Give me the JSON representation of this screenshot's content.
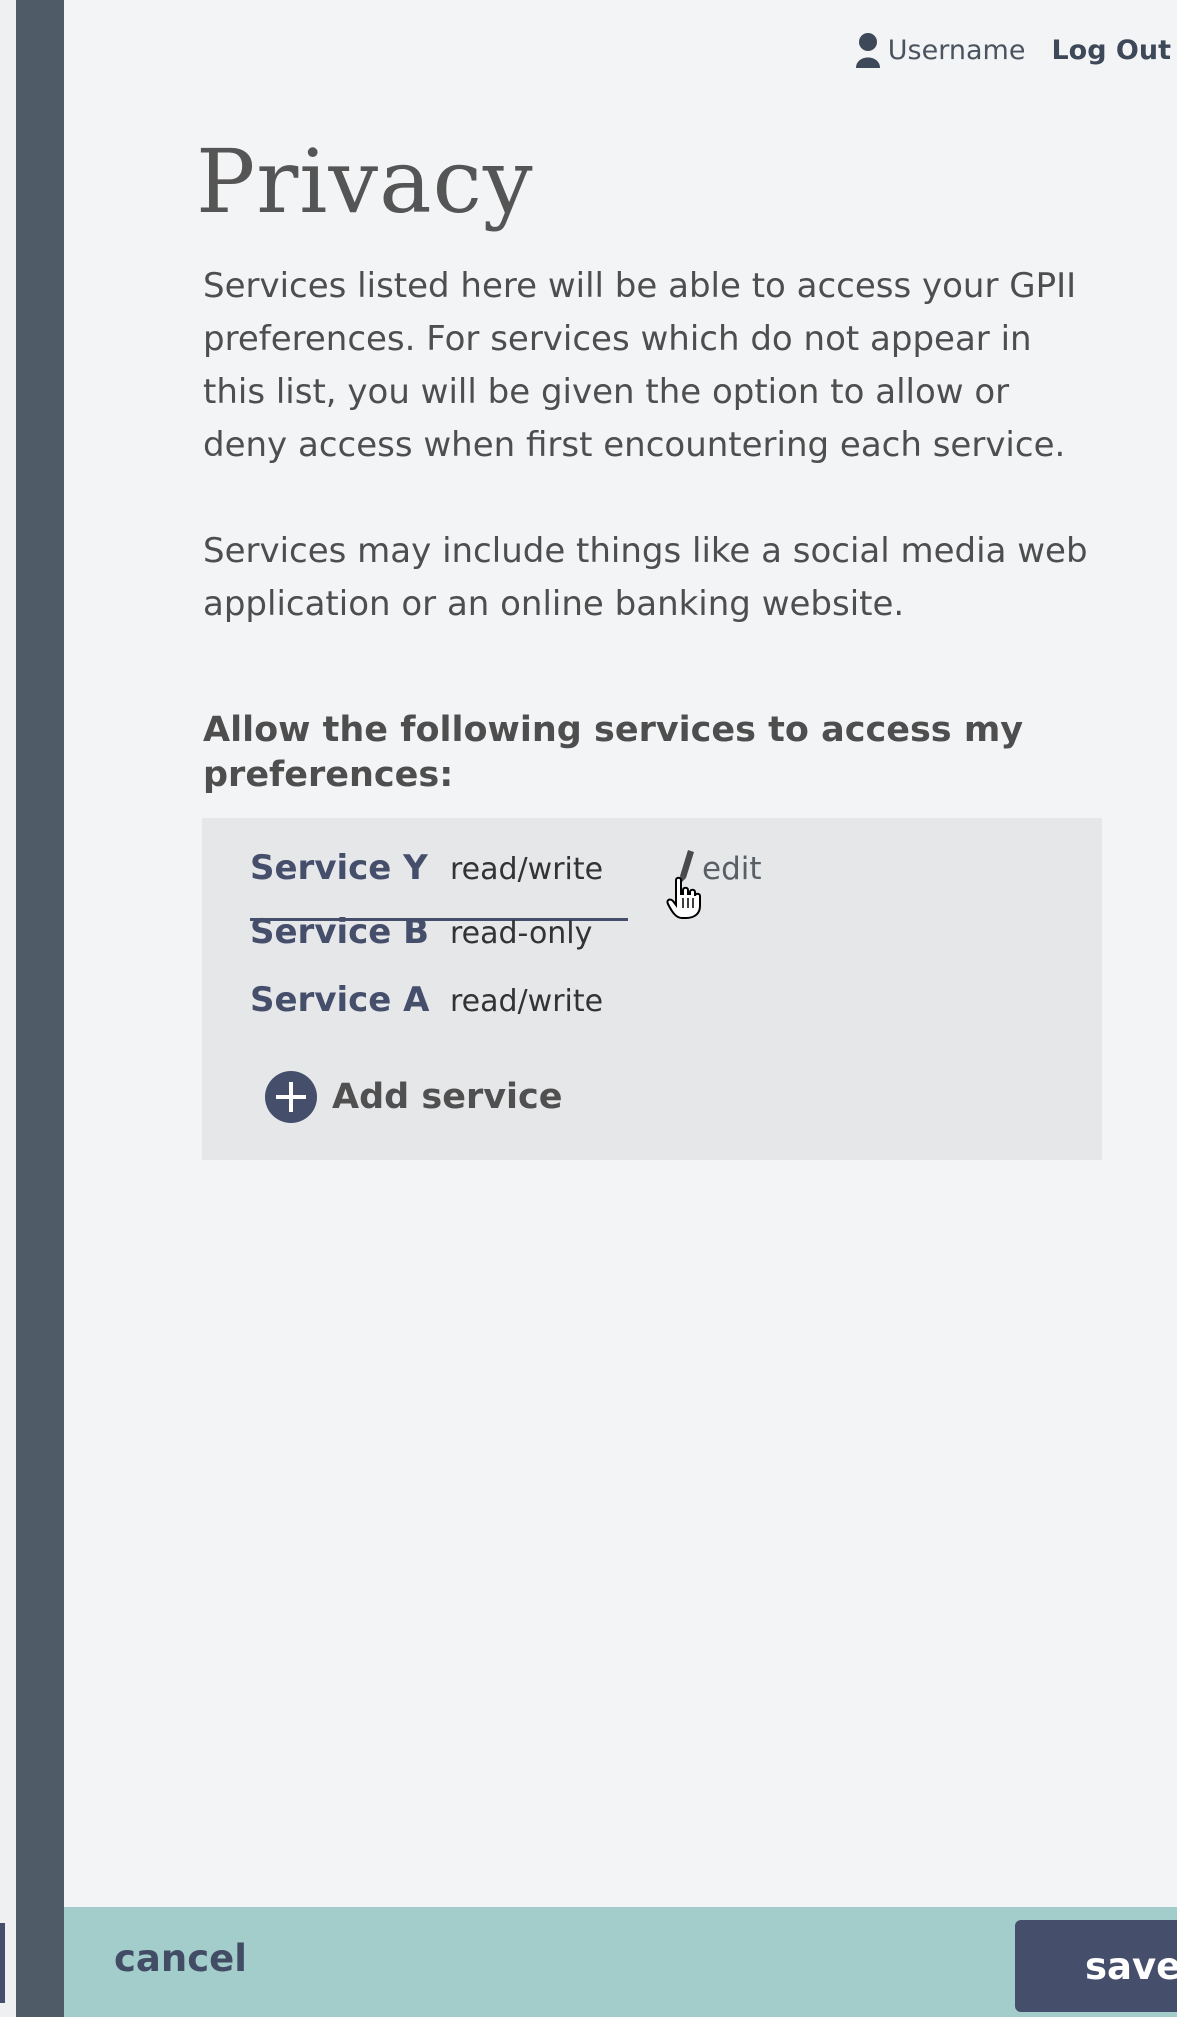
{
  "header": {
    "user_icon": "user-icon",
    "username": "Username",
    "logout_label": "Log Out"
  },
  "page": {
    "title": "Privacy",
    "intro_paragraph_1": "Services listed here will be able to access your GPII preferences. For services which do not appear in this list, you will be given the option to allow or deny access when first encountering each service.",
    "intro_paragraph_2": "Services may include things like a social media web application or an online banking website.",
    "allow_heading": "Allow the following services to access my preferences:"
  },
  "services": [
    {
      "name": "Service Y",
      "permission": "read/write",
      "edit_label": "edit"
    },
    {
      "name": "Service B",
      "permission": "read-only"
    },
    {
      "name": "Service A",
      "permission": "read/write"
    }
  ],
  "add_service": {
    "label": "Add service",
    "icon": "plus-circle-icon"
  },
  "footer": {
    "cancel_label": "cancel",
    "save_label": "save"
  },
  "colors": {
    "sidebar": "#4f5b67",
    "accent": "#454e6b",
    "footer_bg": "#a2cdcb",
    "panel_bg": "#e6e7e9",
    "page_bg": "#f3f4f6"
  }
}
